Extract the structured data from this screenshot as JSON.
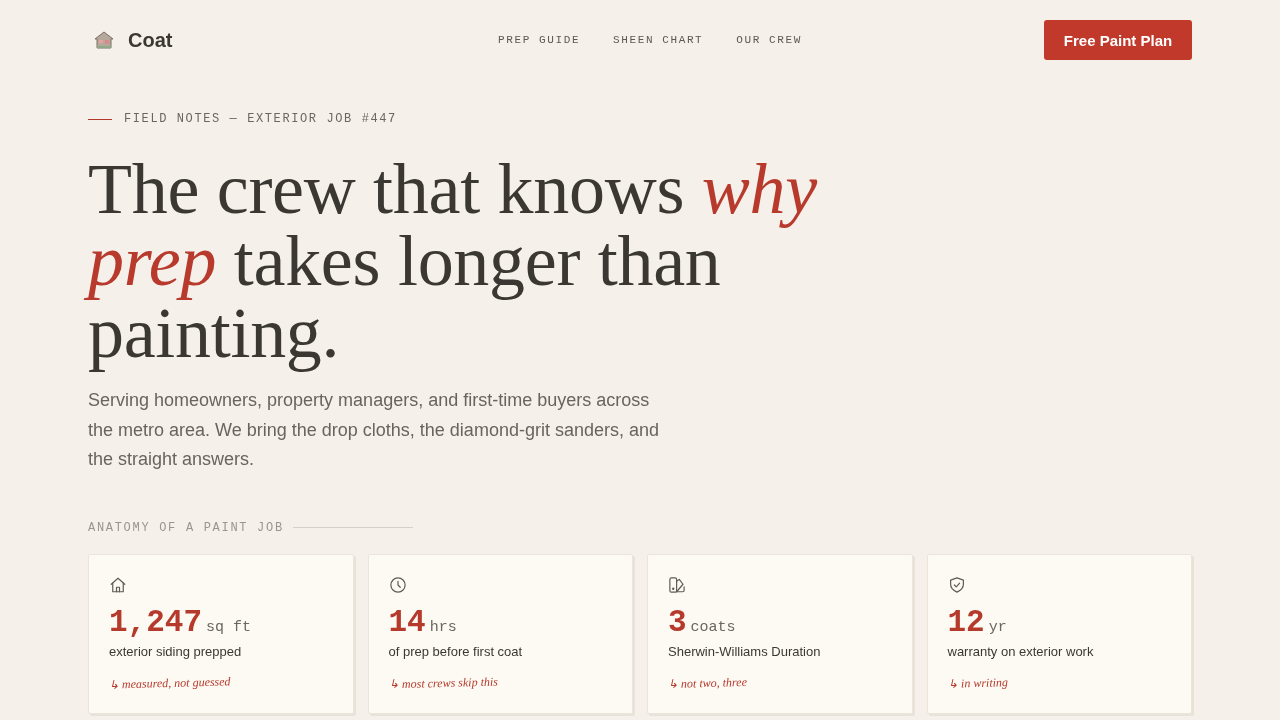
{
  "nav": {
    "brand": "Coat",
    "links": [
      {
        "label": "PREP GUIDE"
      },
      {
        "label": "SHEEN CHART"
      },
      {
        "label": "OUR CREW"
      }
    ],
    "cta": "Free Paint Plan"
  },
  "hero": {
    "eyebrow": "FIELD NOTES — EXTERIOR JOB #447",
    "headline": "The crew that knows *why prep* takes longer than painting.",
    "intro": "Serving homeowners, property managers, and first-time buyers across the metro area. We bring the drop cloths, the diamond-grit sanders, and the straight answers."
  },
  "stats": {
    "heading": "ANATOMY OF A PAINT JOB",
    "cards": [
      {
        "value": "1,247",
        "unit": "sq ft",
        "label": "exterior siding prepped",
        "note": "↳ measured, not guessed"
      },
      {
        "value": "14",
        "unit": "hrs",
        "label": "of prep before first coat",
        "note": "↳ most crews skip this"
      },
      {
        "value": "3",
        "unit": "coats",
        "label": "Sherwin-Williams Duration",
        "note": "↳ not two, three"
      },
      {
        "value": "12",
        "unit": "yr",
        "label": "warranty on exterior work",
        "note": "↳ in writing"
      }
    ]
  }
}
